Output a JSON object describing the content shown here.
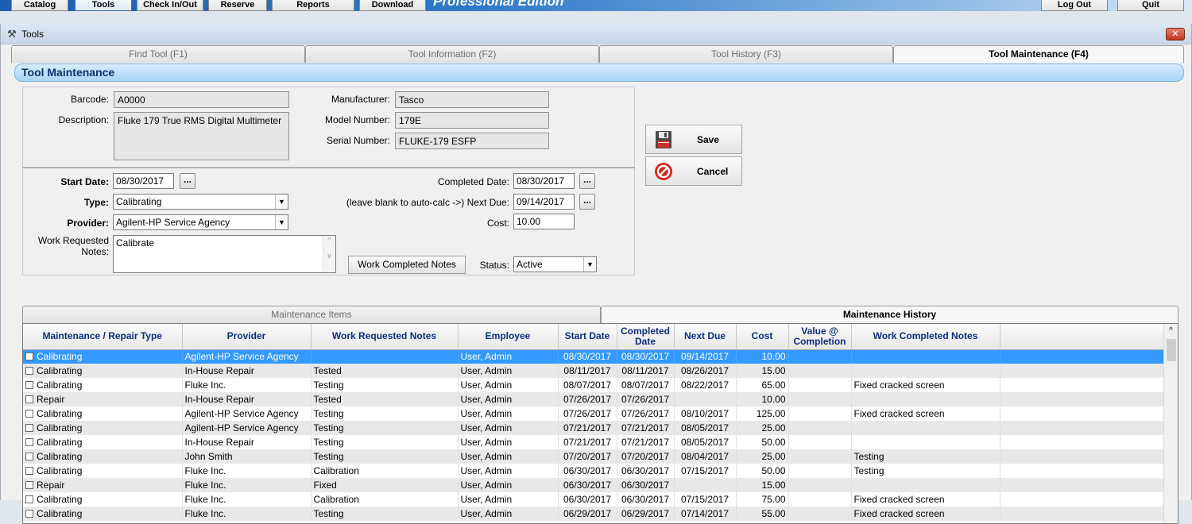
{
  "topbar": {
    "buttons": [
      "Catalog",
      "Tools",
      "Check In/Out",
      "Reserve",
      "Reports",
      "Download"
    ],
    "edition": "Professional Edition",
    "right_buttons": [
      "Log Out",
      "Quit"
    ]
  },
  "window": {
    "title": "Tools",
    "close_label": "✕"
  },
  "tabs": [
    "Find Tool (F1)",
    "Tool Information (F2)",
    "Tool History (F3)",
    "Tool Maintenance (F4)"
  ],
  "section_title": "Tool Maintenance",
  "tool": {
    "barcode_label": "Barcode:",
    "barcode": "A0000",
    "description_label": "Description:",
    "description": "Fluke 179 True RMS Digital Multimeter",
    "manufacturer_label": "Manufacturer:",
    "manufacturer": "Tasco",
    "model_label": "Model Number:",
    "model": "179E",
    "serial_label": "Serial Number:",
    "serial": "FLUKE-179 ESFP"
  },
  "form": {
    "start_date_label": "Start Date:",
    "start_date": "08/30/2017",
    "type_label": "Type:",
    "type": "Calibrating",
    "provider_label": "Provider:",
    "provider": "Agilent-HP Service Agency",
    "work_requested_label_1": "Work Requested",
    "work_requested_label_2": "Notes:",
    "work_requested": "Calibrate",
    "completed_date_label": "Completed Date:",
    "completed_date": "08/30/2017",
    "next_due_label": "(leave blank to auto-calc ->)  Next Due:",
    "next_due": "09/14/2017",
    "cost_label": "Cost:",
    "cost": "10.00",
    "work_completed_button": "Work Completed Notes",
    "status_label": "Status:",
    "status": "Active",
    "dots": "..."
  },
  "actions": {
    "save": "Save",
    "cancel": "Cancel"
  },
  "subtabs": [
    "Maintenance Items",
    "Maintenance History"
  ],
  "grid": {
    "columns": [
      "Maintenance / Repair Type",
      "Provider",
      "Work Requested Notes",
      "Employee",
      "Start Date",
      "Completed Date",
      "Next Due",
      "Cost",
      "Value @ Completion",
      "Work Completed Notes",
      ""
    ],
    "rows": [
      {
        "type": "Calibrating",
        "provider": "Agilent-HP Service Agency",
        "requested": "",
        "employee": "User, Admin",
        "start": "08/30/2017",
        "completed": "08/30/2017",
        "next": "09/14/2017",
        "cost": "10.00",
        "value": "",
        "done": ""
      },
      {
        "type": "Calibrating",
        "provider": "In-House Repair",
        "requested": "Tested",
        "employee": "User, Admin",
        "start": "08/11/2017",
        "completed": "08/11/2017",
        "next": "08/26/2017",
        "cost": "15.00",
        "value": "",
        "done": ""
      },
      {
        "type": "Calibrating",
        "provider": "Fluke Inc.",
        "requested": "Testing",
        "employee": "User, Admin",
        "start": "08/07/2017",
        "completed": "08/07/2017",
        "next": "08/22/2017",
        "cost": "65.00",
        "value": "",
        "done": "Fixed cracked screen"
      },
      {
        "type": "Repair",
        "provider": "In-House Repair",
        "requested": "Tested",
        "employee": "User, Admin",
        "start": "07/26/2017",
        "completed": "07/26/2017",
        "next": "",
        "cost": "10.00",
        "value": "",
        "done": ""
      },
      {
        "type": "Calibrating",
        "provider": "Agilent-HP Service Agency",
        "requested": "Testing",
        "employee": "User, Admin",
        "start": "07/26/2017",
        "completed": "07/26/2017",
        "next": "08/10/2017",
        "cost": "125.00",
        "value": "",
        "done": "Fixed cracked screen"
      },
      {
        "type": "Calibrating",
        "provider": "Agilent-HP Service Agency",
        "requested": "Testing",
        "employee": "User, Admin",
        "start": "07/21/2017",
        "completed": "07/21/2017",
        "next": "08/05/2017",
        "cost": "25.00",
        "value": "",
        "done": ""
      },
      {
        "type": "Calibrating",
        "provider": "In-House Repair",
        "requested": "Testing",
        "employee": "User, Admin",
        "start": "07/21/2017",
        "completed": "07/21/2017",
        "next": "08/05/2017",
        "cost": "50.00",
        "value": "",
        "done": ""
      },
      {
        "type": "Calibrating",
        "provider": "John Smith",
        "requested": "Testing",
        "employee": "User, Admin",
        "start": "07/20/2017",
        "completed": "07/20/2017",
        "next": "08/04/2017",
        "cost": "25.00",
        "value": "",
        "done": "Testing"
      },
      {
        "type": "Calibrating",
        "provider": "Fluke Inc.",
        "requested": "Calibration",
        "employee": "User, Admin",
        "start": "06/30/2017",
        "completed": "06/30/2017",
        "next": "07/15/2017",
        "cost": "50.00",
        "value": "",
        "done": "Testing"
      },
      {
        "type": "Repair",
        "provider": "Fluke Inc.",
        "requested": "Fixed",
        "employee": "User, Admin",
        "start": "06/30/2017",
        "completed": "06/30/2017",
        "next": "",
        "cost": "15.00",
        "value": "",
        "done": ""
      },
      {
        "type": "Calibrating",
        "provider": "Fluke Inc.",
        "requested": "Calibration",
        "employee": "User, Admin",
        "start": "06/30/2017",
        "completed": "06/30/2017",
        "next": "07/15/2017",
        "cost": "75.00",
        "value": "",
        "done": "Fixed cracked screen"
      },
      {
        "type": "Calibrating",
        "provider": "Fluke Inc.",
        "requested": "Testing",
        "employee": "User, Admin",
        "start": "06/29/2017",
        "completed": "06/29/2017",
        "next": "07/14/2017",
        "cost": "55.00",
        "value": "",
        "done": "Fixed cracked screen"
      }
    ],
    "selected_row": 0
  },
  "icons": {
    "window": "tools-icon",
    "save": "floppy-disk-icon",
    "cancel": "no-entry-icon"
  },
  "colors": {
    "selection": "#3399ff",
    "header_text": "#0c2d82",
    "section_bar": "#a8d4f6"
  }
}
